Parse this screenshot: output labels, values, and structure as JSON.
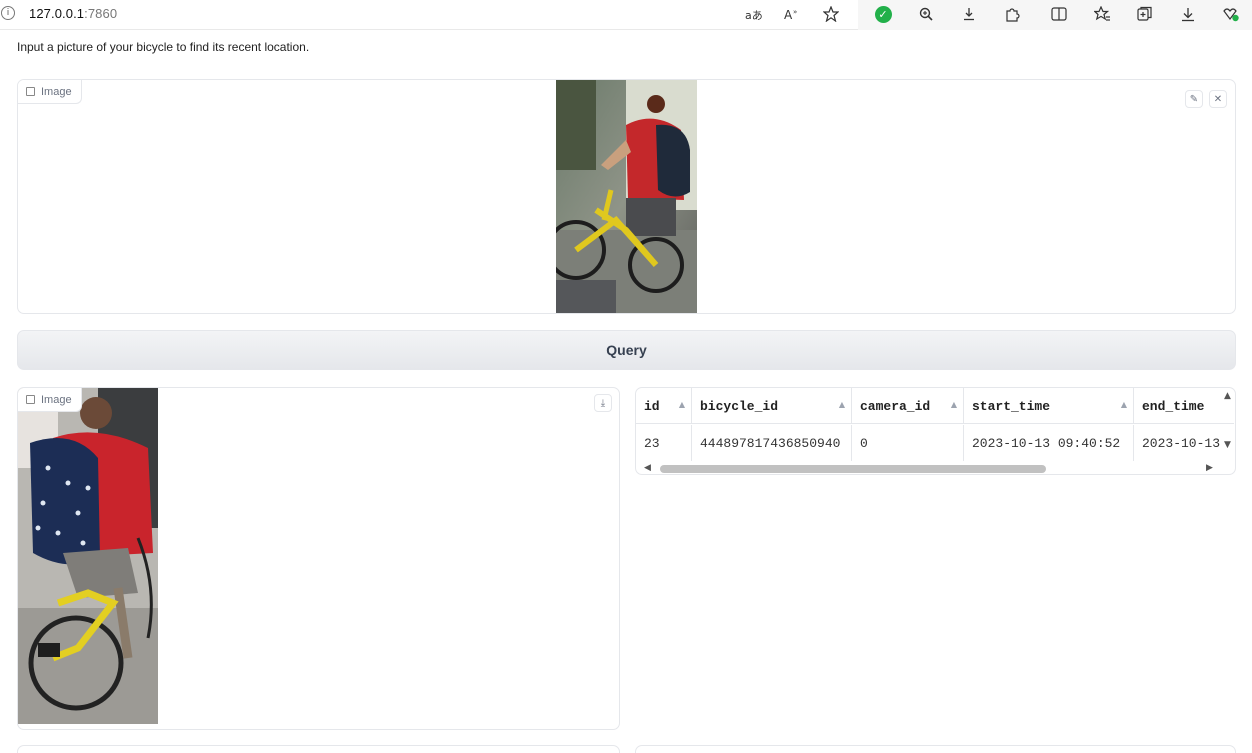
{
  "browser": {
    "url_host": "127.0.0.1",
    "url_port": ":7860",
    "info_glyph": "i",
    "icons": [
      "read-aloud-translate-icon",
      "text-size-icon",
      "favorite-star-icon",
      "extension-check-icon",
      "zoom-icon",
      "download-arrow-icon",
      "extensions-puzzle-icon",
      "split-screen-icon",
      "favorites-icon",
      "collections-icon",
      "downloads-icon",
      "profile-icon"
    ]
  },
  "description": "Input a picture of your bicycle to find its recent location.",
  "input_image": {
    "label": "Image",
    "edit_glyph": "✎",
    "close_glyph": "✕"
  },
  "query_button": "Query",
  "output_image": {
    "label": "Image",
    "download_glyph": "⤓"
  },
  "results_table": {
    "columns": [
      "id",
      "bicycle_id",
      "camera_id",
      "start_time",
      "end_time"
    ],
    "rows": [
      [
        "23",
        "444897817436850940",
        "0",
        "2023-10-13 09:40:52",
        "2023-10-13"
      ]
    ],
    "sort_glyph": "▲"
  }
}
